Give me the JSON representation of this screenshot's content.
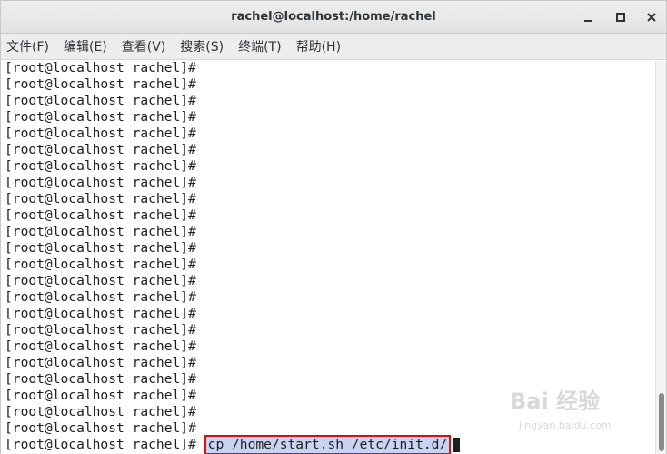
{
  "window": {
    "title": "rachel@localhost:/home/rachel",
    "controls": {
      "minimize": "_",
      "maximize": "□",
      "close": "×"
    }
  },
  "menu": [
    {
      "label": "文件(F)"
    },
    {
      "label": "编辑(E)"
    },
    {
      "label": "查看(V)"
    },
    {
      "label": "搜索(S)"
    },
    {
      "label": "终端(T)"
    },
    {
      "label": "帮助(H)"
    }
  ],
  "terminal": {
    "prompt": "[root@localhost rachel]# ",
    "empty_prompt_lines": 23,
    "command": "cp /home/start.sh /etc/init.d/"
  },
  "scrollbar": {
    "position": 0.95
  },
  "watermark": {
    "logo": "Bai 经验",
    "url": "jingyan.baidu.com"
  }
}
